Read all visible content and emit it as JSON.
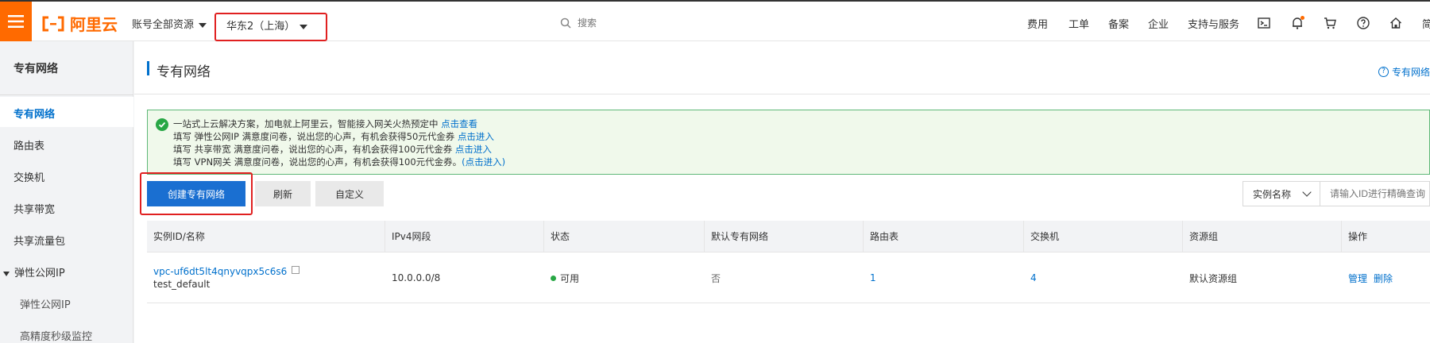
{
  "brand": {
    "logo_text": "阿里云",
    "accent": "#ff6a00"
  },
  "header": {
    "account_resources": "账号全部资源",
    "region": "华东2（上海）",
    "search_placeholder": "搜索",
    "nav": [
      "费用",
      "工单",
      "备案",
      "企业",
      "支持与服务"
    ],
    "cut_text": "简"
  },
  "sidebar": {
    "title": "专有网络",
    "items": [
      "专有网络",
      "路由表",
      "交换机",
      "共享带宽",
      "共享流量包"
    ],
    "group": {
      "label": "弹性公网IP",
      "children": [
        "弹性公网IP",
        "高精度秒级监控"
      ]
    }
  },
  "page": {
    "title": "专有网络",
    "help": "专有网络"
  },
  "notice": {
    "line1": "一站式上云解决方案，加电就上阿里云，智能接入网关火热预定中",
    "line1_link": "点击查看",
    "line2": "填写 弹性公网IP 满意度问卷，说出您的心声，有机会获得50元代金券",
    "line2_link": "点击进入",
    "line3": "填写 共享带宽 满意度问卷，说出您的心声，有机会获得100元代金券",
    "line3_link": "点击进入",
    "line4": "填写 VPN网关 满意度问卷，说出您的心声，有机会获得100元代金券。",
    "line4_link": "(点击进入)"
  },
  "toolbar": {
    "create_label": "创建专有网络",
    "refresh_label": "刷新",
    "custom_label": "自定义",
    "filter_select": "实例名称",
    "filter_placeholder": "请输入ID进行精确查询"
  },
  "table": {
    "columns": [
      "实例ID/名称",
      "IPv4网段",
      "状态",
      "默认专有网络",
      "路由表",
      "交换机",
      "资源组",
      "操作"
    ],
    "rows": [
      {
        "id": "vpc-uf6dt5lt4qnyvqpx5c6s6",
        "name": "test_default",
        "cidr": "10.0.0.0/8",
        "status": "可用",
        "default_vpc": "否",
        "route_tables": "1",
        "vswitches": "4",
        "resource_group": "默认资源组",
        "action_manage": "管理",
        "action_delete": "删除"
      }
    ]
  }
}
